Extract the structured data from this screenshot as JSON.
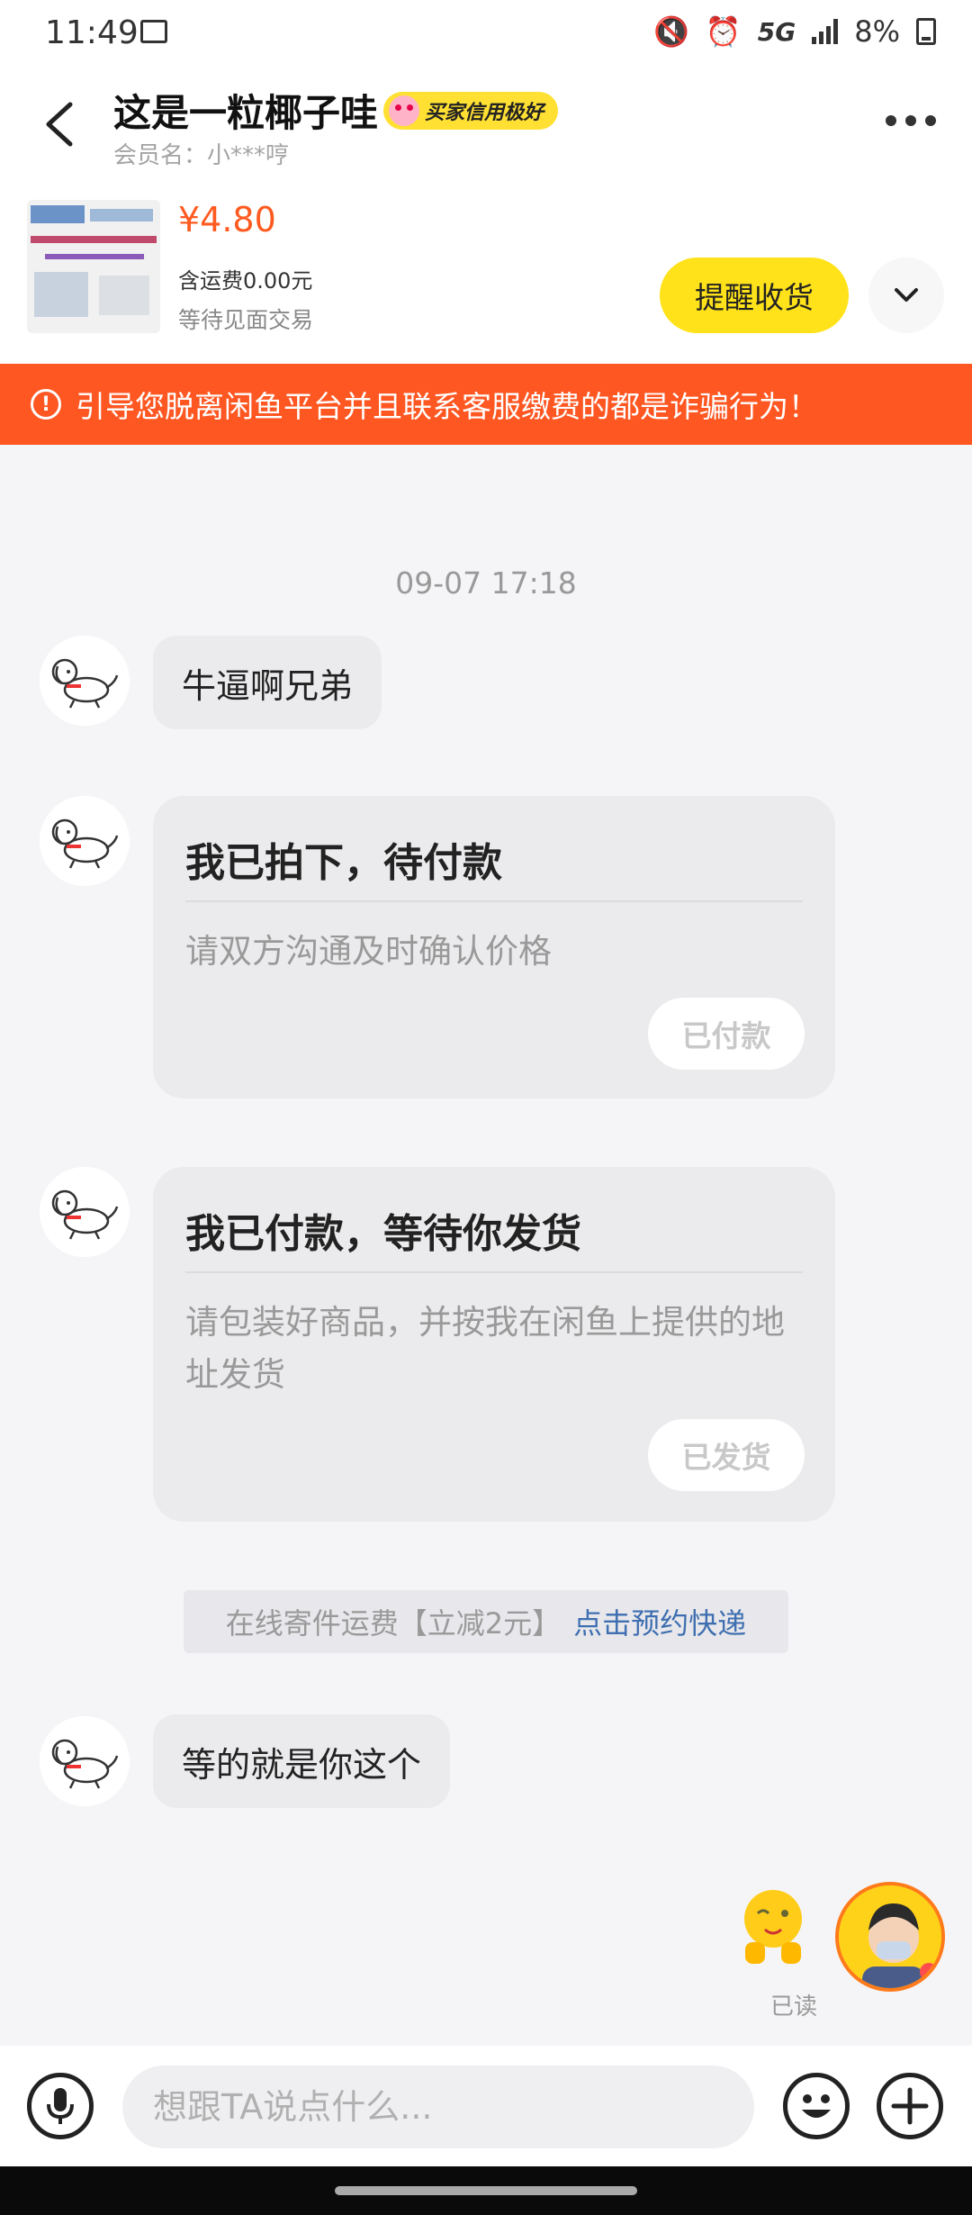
{
  "status_bar": {
    "time": "11:49",
    "network": "5G",
    "battery": "8%"
  },
  "header": {
    "title": "这是一粒椰子哇",
    "credit_badge": "买家信用极好",
    "member_label": "会员名：小***哼"
  },
  "product": {
    "price": "¥4.80",
    "shipping": "含运费0.00元",
    "status": "等待见面交易",
    "remind_button": "提醒收货"
  },
  "warning": {
    "icon": "!",
    "text": "引导您脱离闲鱼平台并且联系客服缴费的都是诈骗行为！"
  },
  "chat": {
    "timestamp": "09-07 17:18",
    "msg1": "牛逼啊兄弟",
    "card1": {
      "title": "我已拍下，待付款",
      "desc": "请双方沟通及时确认价格",
      "button": "已付款"
    },
    "card2": {
      "title": "我已付款，等待你发货",
      "desc": "请包装好商品，并按我在闲鱼上提供的地址发货",
      "button": "已发货"
    },
    "system_tip": "在线寄件运费【立减2元】",
    "system_link": "点击预约快递",
    "msg2": "等的就是你这个",
    "read_label": "已读"
  },
  "input_bar": {
    "placeholder": "想跟TA说点什么..."
  },
  "colors": {
    "accent_yellow": "#ffe21a",
    "warning_orange": "#ff5722",
    "price_orange": "#ff5a1f",
    "link_blue": "#3f6fb0"
  }
}
